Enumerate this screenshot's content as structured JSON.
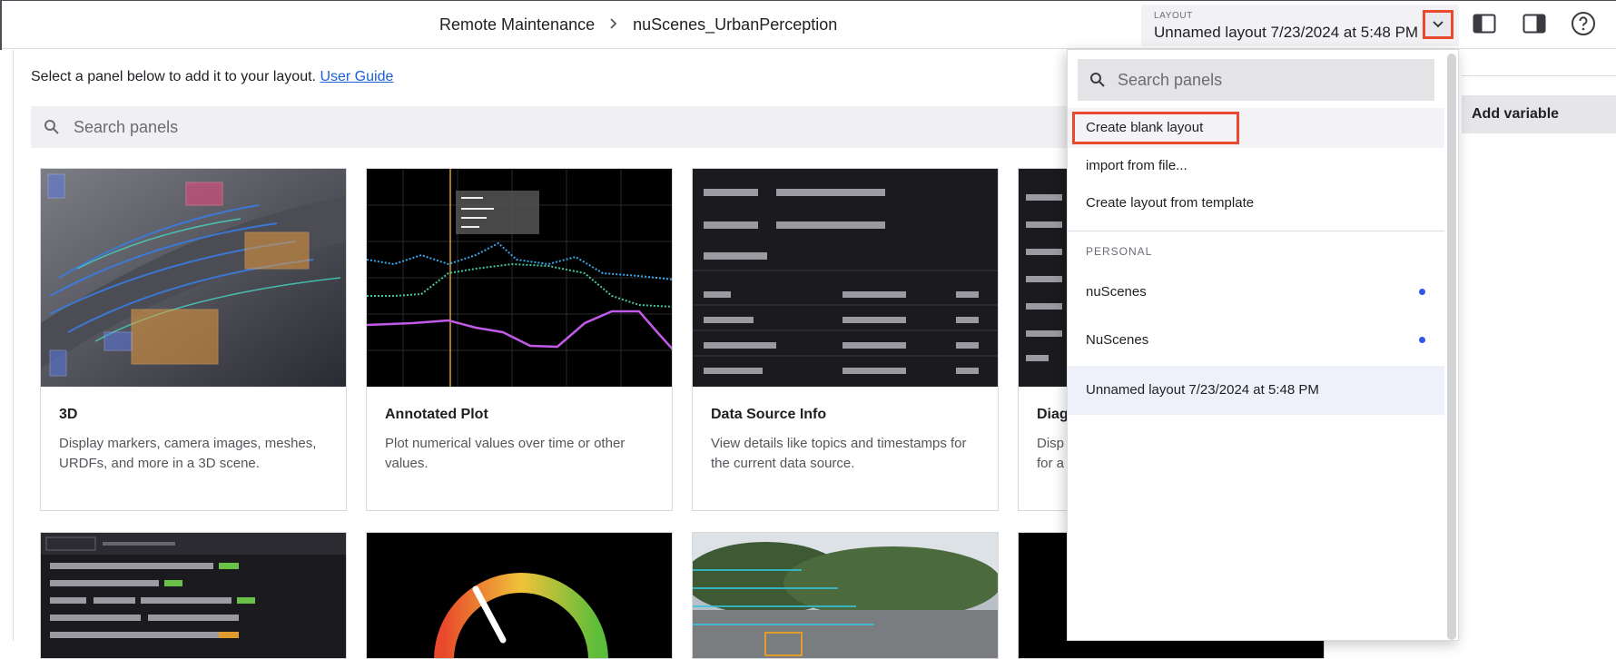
{
  "topbar": {
    "breadcrumb": [
      "Remote Maintenance",
      "nuScenes_UrbanPerception"
    ],
    "layout_caption": "LAYOUT",
    "layout_name": "Unnamed layout 7/23/2024 at 5:48 PM",
    "icons": [
      "chevron-down-icon",
      "left-sidebar-icon",
      "right-sidebar-icon",
      "help-icon"
    ]
  },
  "main": {
    "intro_text": "Select a panel below to add it to your layout.",
    "intro_link": "User Guide",
    "search_placeholder": "Search panels",
    "cards": [
      {
        "title": "3D",
        "desc": "Display markers, camera images, meshes, URDFs, and more in a 3D scene."
      },
      {
        "title": "Annotated Plot",
        "desc": "Plot numerical values over time or other values."
      },
      {
        "title": "Data Source Info",
        "desc": "View details like topics and timestamps for the current data source."
      },
      {
        "title": "Diag",
        "desc": "Disp for a"
      }
    ]
  },
  "right_panel": {
    "add_variable_label": "Add variable"
  },
  "dropdown": {
    "search_placeholder": "Search panels",
    "actions": [
      "Create blank layout",
      "import from file...",
      "Create layout from template"
    ],
    "section_label": "PERSONAL",
    "layouts": [
      {
        "name": "nuScenes",
        "unsaved": true
      },
      {
        "name": "NuScenes",
        "unsaved": true
      },
      {
        "name": "Unnamed layout 7/23/2024 at 5:48 PM",
        "selected": true
      }
    ]
  },
  "colors": {
    "highlight_box": "#e8492f",
    "link": "#1a5fd8",
    "unsaved_dot": "#2f58e8"
  }
}
